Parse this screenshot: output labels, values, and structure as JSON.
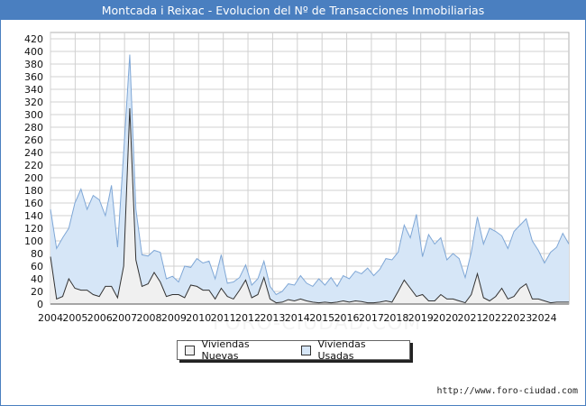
{
  "title": "Montcada i Reixac - Evolucion del Nº de Transacciones Inmobiliarias",
  "source": "http://www.foro-ciudad.com",
  "watermark": "FORO-CIUDAD.COM",
  "legend": {
    "nuevas": "Viviendas Nuevas",
    "usadas": "Viviendas Usadas"
  },
  "colors": {
    "header": "#4a7fc0",
    "usadas_fill": "#d6e6f7",
    "usadas_line": "#7fa7d6",
    "nuevas_fill": "#f0f0f0",
    "nuevas_line": "#333333",
    "grid": "#d0d0d0"
  },
  "chart_data": {
    "type": "area",
    "title": "Montcada i Reixac - Evolucion del Nº de Transacciones Inmobiliarias",
    "xlabel": "",
    "ylabel": "",
    "ylim": [
      0,
      430
    ],
    "yticks": [
      0,
      20,
      40,
      60,
      80,
      100,
      120,
      140,
      160,
      180,
      200,
      220,
      240,
      260,
      280,
      300,
      320,
      340,
      360,
      380,
      400,
      420
    ],
    "xtick_labels": [
      "2004",
      "2005",
      "2006",
      "2007",
      "2008",
      "2009",
      "2010",
      "2011",
      "2012",
      "2013",
      "2014",
      "2015",
      "2016",
      "2017",
      "2018",
      "2019",
      "2020",
      "2021",
      "2022",
      "2023",
      "2024"
    ],
    "x_start": "2004 Q1",
    "period": "quarter",
    "grid": true,
    "legend_position": "bottom",
    "series": [
      {
        "name": "Viviendas Usadas",
        "values": [
          150,
          88,
          105,
          120,
          160,
          182,
          150,
          172,
          165,
          140,
          188,
          90,
          240,
          395,
          150,
          78,
          76,
          85,
          82,
          40,
          44,
          35,
          60,
          58,
          72,
          65,
          68,
          40,
          78,
          33,
          35,
          42,
          62,
          30,
          40,
          68,
          28,
          15,
          20,
          32,
          30,
          45,
          33,
          28,
          40,
          30,
          42,
          28,
          45,
          40,
          52,
          48,
          57,
          45,
          55,
          72,
          70,
          82,
          125,
          105,
          142,
          75,
          110,
          95,
          105,
          70,
          80,
          72,
          42,
          82,
          138,
          95,
          120,
          115,
          108,
          88,
          115,
          125,
          135,
          100,
          85,
          65,
          82,
          90,
          112,
          95
        ]
      },
      {
        "name": "Viviendas Nuevas",
        "values": [
          75,
          8,
          12,
          40,
          25,
          22,
          22,
          15,
          12,
          28,
          28,
          10,
          60,
          310,
          70,
          28,
          32,
          50,
          35,
          12,
          15,
          15,
          10,
          30,
          28,
          22,
          22,
          8,
          25,
          12,
          8,
          22,
          38,
          10,
          15,
          42,
          8,
          2,
          3,
          7,
          5,
          8,
          5,
          3,
          2,
          3,
          2,
          3,
          5,
          3,
          5,
          4,
          2,
          2,
          3,
          5,
          3,
          20,
          38,
          25,
          12,
          15,
          5,
          5,
          15,
          8,
          8,
          5,
          2,
          15,
          48,
          10,
          5,
          12,
          25,
          8,
          12,
          25,
          32,
          8,
          8,
          5,
          2,
          3,
          3,
          3
        ]
      }
    ]
  }
}
